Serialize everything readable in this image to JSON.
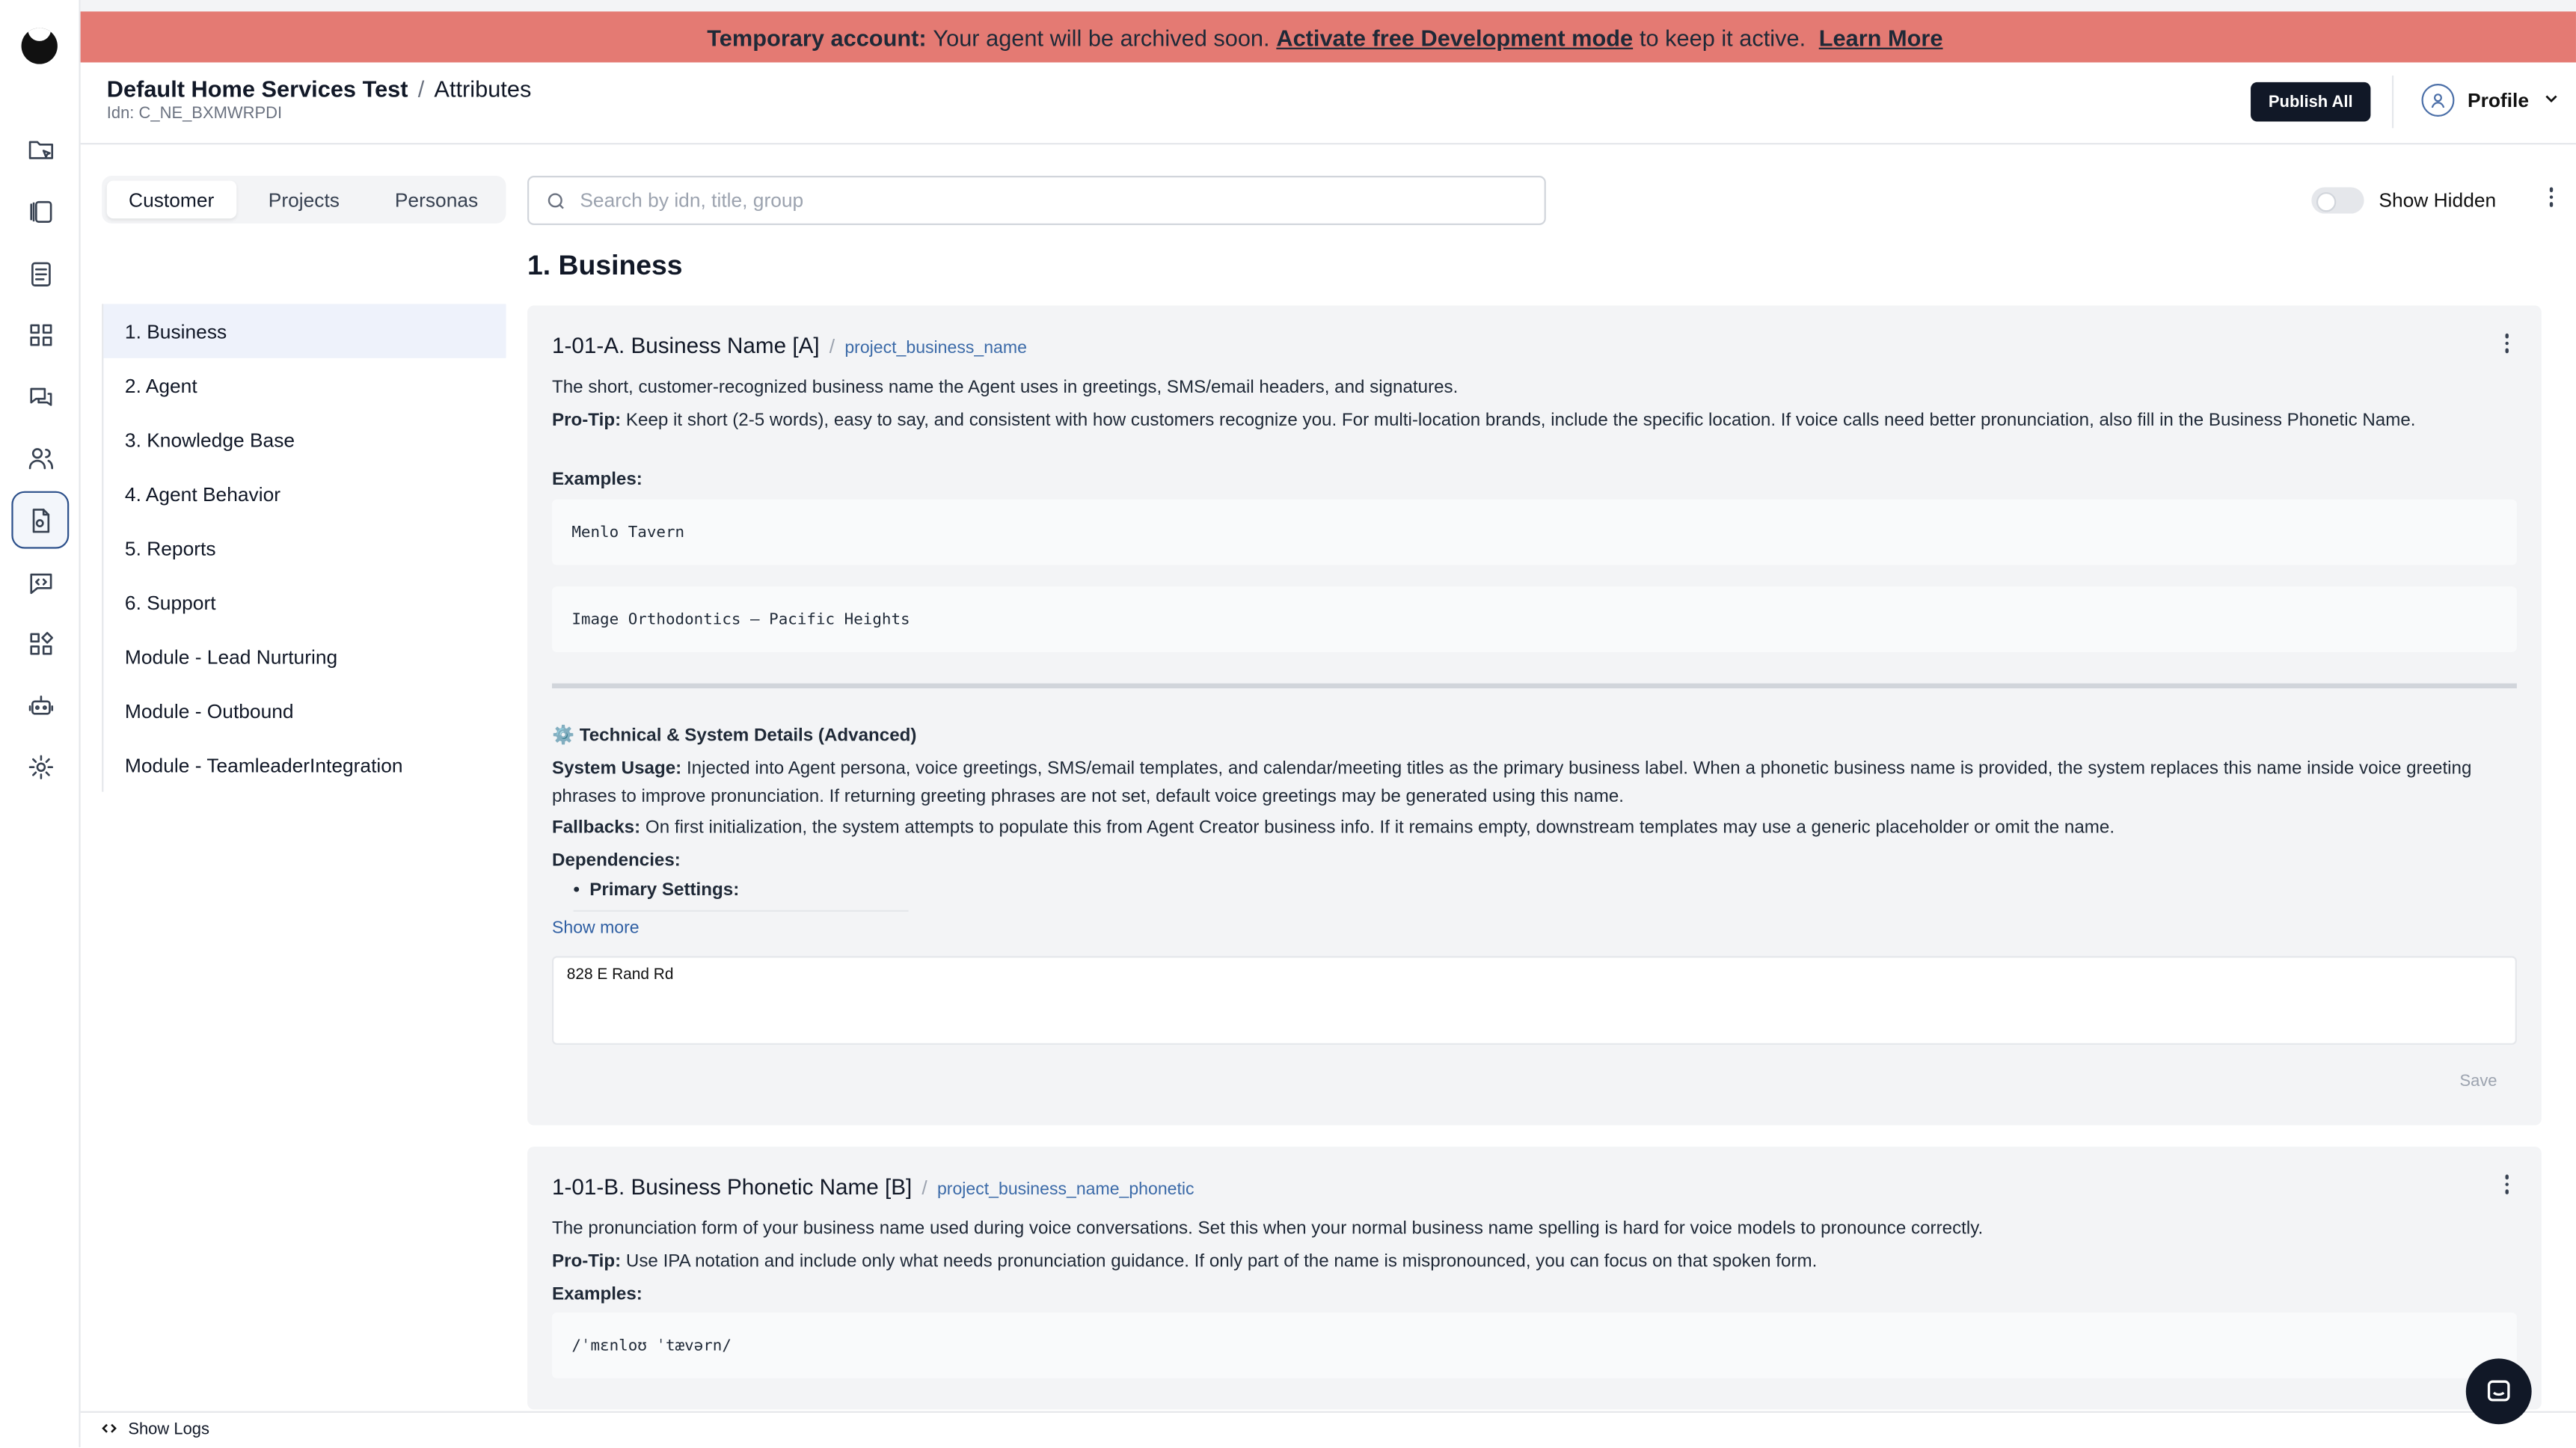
{
  "banner": {
    "prefix": "Temporary account:",
    "message": "Your agent will be archived soon.",
    "activate_link": "Activate free Development mode",
    "suffix": "to keep it active.",
    "learn_more": "Learn More",
    "color": "#e47a73"
  },
  "header": {
    "breadcrumb_root": "Default Home Services Test",
    "breadcrumb_sep": "/",
    "breadcrumb_current": "Attributes",
    "idn": "Idn: C_NE_BXMWRPDI",
    "publish_label": "Publish All",
    "profile_label": "Profile"
  },
  "rail": {
    "icons": [
      "logo",
      "folder-cursor-icon",
      "columns-icon",
      "document-icon",
      "grid-icon",
      "chat-bubbles-icon",
      "users-icon",
      "file-settings-icon",
      "code-message-icon",
      "widgets-icon",
      "robot-icon",
      "gear-icon"
    ],
    "active": "file-settings-icon"
  },
  "tabs": [
    "Customer",
    "Projects",
    "Personas"
  ],
  "active_tab": "Customer",
  "sidebar": {
    "items": [
      "1. Business",
      "2. Agent",
      "3. Knowledge Base",
      "4. Agent Behavior",
      "5. Reports",
      "6. Support",
      "Module - Lead Nurturing",
      "Module - Outbound",
      "Module - TeamleaderIntegration"
    ],
    "active": "1. Business"
  },
  "search": {
    "placeholder": "Search by idn, title, group"
  },
  "show_hidden_label": "Show Hidden",
  "section_title": "1. Business",
  "card1": {
    "title": "1-01-A. Business Name [A]",
    "key": "project_business_name",
    "description": "The short, customer-recognized business name the Agent uses in greetings, SMS/email headers, and signatures.",
    "protip_label": "Pro-Tip:",
    "protip": "Keep it short (2-5 words), easy to say, and consistent with how customers recognize you. For multi-location brands, include the specific location. If voice calls need better pronunciation, also fill in the Business Phonetic Name.",
    "examples_label": "Examples:",
    "examples": [
      "Menlo Tavern",
      "Image Orthodontics – Pacific Heights"
    ],
    "tech_title": "⚙️ Technical & System Details (Advanced)",
    "system_usage_label": "System Usage:",
    "system_usage": "Injected into Agent persona, voice greetings, SMS/email templates, and calendar/meeting titles as the primary business label. When a phonetic business name is provided, the system replaces this name inside voice greeting phrases to improve pronunciation. If returning greeting phrases are not set, default voice greetings may be generated using this name.",
    "fallbacks_label": "Fallbacks:",
    "fallbacks": "On first initialization, the system attempts to populate this from Agent Creator business info. If it remains empty, downstream templates may use a generic placeholder or omit the name.",
    "dependencies_label": "Dependencies:",
    "primary_settings": "Primary Settings:",
    "show_more": "Show more",
    "value": "828 E Rand Rd",
    "save_label": "Save"
  },
  "card2": {
    "title": "1-01-B. Business Phonetic Name [B]",
    "key": "project_business_name_phonetic",
    "description": "The pronunciation form of your business name used during voice conversations. Set this when your normal business name spelling is hard for voice models to pronounce correctly.",
    "protip_label": "Pro-Tip:",
    "protip": "Use IPA notation and include only what needs pronunciation guidance. If only part of the name is mispronounced, you can focus on that spoken form.",
    "examples_label": "Examples:",
    "examples": [
      "/ˈmɛnloʊ ˈtævərn/"
    ]
  },
  "footer": {
    "show_logs": "Show Logs"
  }
}
